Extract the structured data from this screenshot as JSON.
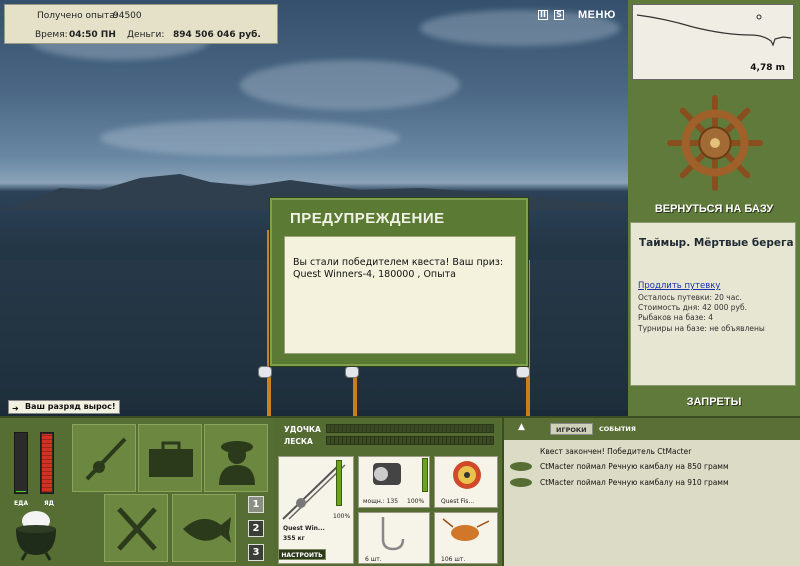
{
  "hud": {
    "exp_label": "Получено опыта:",
    "exp_value": "94500",
    "time_label": "Время:",
    "time_value": "04:50 ПН",
    "money_label": "Деньги:",
    "money_value": "894 506 046 руб."
  },
  "top_controls": {
    "pause": "II",
    "sound": "S",
    "menu": "МЕНЮ"
  },
  "depth": {
    "value": "4,78 m"
  },
  "right_panel": {
    "return_label": "ВЕРНУТЬСЯ НА БАЗУ",
    "location": "Таймыр. Мёртвые берега",
    "extend_link": "Продлить путевку",
    "info": [
      "Осталось путевки: 20 час.",
      "Стоимость дня: 42 000 руб.",
      "Рыбаков на базе: 4",
      "Турниры на базе: не объявлены"
    ],
    "bans_label": "ЗАПРЕТЫ"
  },
  "dialog": {
    "title": "ПРЕДУПРЕЖДЕНИЕ",
    "message": "Вы стали победителем квеста! Ваш приз: Quest Winners-4, 180000 , Опыта"
  },
  "notice": "Ваш разряд вырос!",
  "needs": {
    "food_label": "ЕДА",
    "poison_label": "ЯД",
    "food_level": 0.05,
    "poison_level": 1.0
  },
  "numbers": [
    "1",
    "2",
    "3"
  ],
  "tackle": {
    "rod_label": "УДОЧКА",
    "line_label": "ЛЕСКА",
    "rod_name": "Quest Win...",
    "rod_weight": "355 кг",
    "rod_percent": "100%",
    "reel_power": "мощн.: 135",
    "reel_percent": "100%",
    "line_name": "Quest Fis...",
    "hooks_count": "6 шт.",
    "bait_count": "106 шт.",
    "setup_button": "НАСТРОИТЬ"
  },
  "events": {
    "tab_players": "ИГРОКИ",
    "tab_events": "СОБЫТИЯ",
    "rows": [
      "Квест закончен! Победитель CtMacter",
      "CtMacter поймал Речную камбалу на 850 грамм",
      "CtMacter поймал Речную камбалу на 910 грамм"
    ]
  }
}
